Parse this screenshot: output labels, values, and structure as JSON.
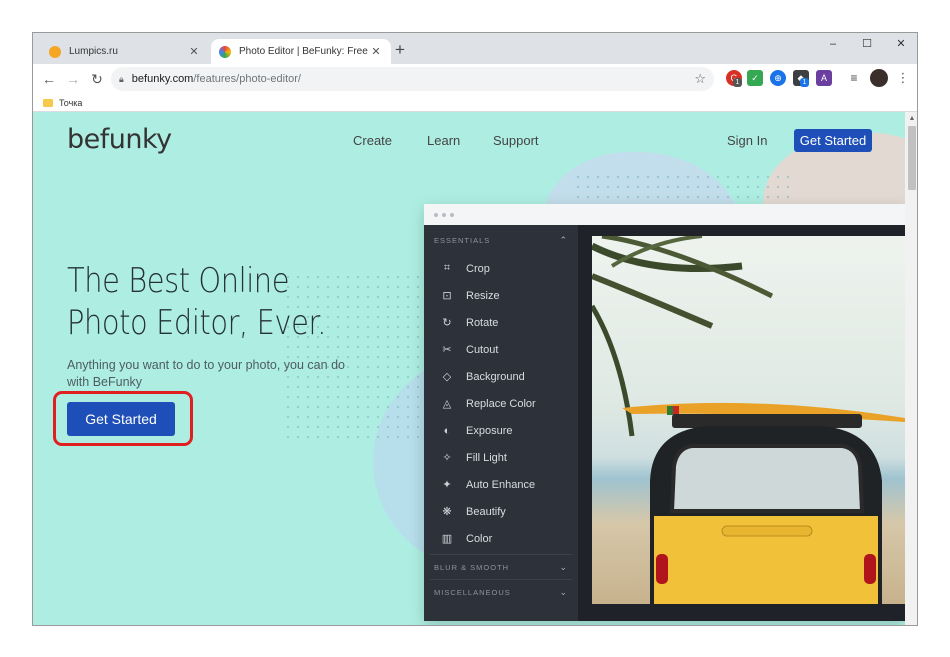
{
  "browser": {
    "tabs": [
      {
        "title": "Lumpics.ru",
        "favicon_color": "#f5a623",
        "active": false
      },
      {
        "title": "Photo Editor | BeFunky: Free Onl",
        "favicon_color": "#e8453c",
        "active": true
      }
    ],
    "new_tab_symbol": "+",
    "window_controls": [
      "–",
      "☐",
      "✕"
    ],
    "address": {
      "host": "befunky.com",
      "path": "/features/photo-editor/"
    },
    "bookmark": "Точка",
    "ext_badges": [
      "1",
      "1"
    ]
  },
  "site": {
    "logo": "befunky",
    "nav": [
      "Create",
      "Learn",
      "Support"
    ],
    "sign_in": "Sign In",
    "header_cta": "Get Started",
    "hero_title": "The Best Online Photo Editor, Ever.",
    "hero_subtitle": "Anything you want to do to your photo, you can do with BeFunky",
    "hero_cta": "Get Started",
    "accent_color": "#1e4eb7",
    "background_color": "#aeeee2"
  },
  "editor": {
    "section_title": "ESSENTIALS",
    "tools": [
      {
        "label": "Crop",
        "icon": "crop-icon",
        "glyph": "⌗"
      },
      {
        "label": "Resize",
        "icon": "resize-icon",
        "glyph": "⊡"
      },
      {
        "label": "Rotate",
        "icon": "rotate-icon",
        "glyph": "↻"
      },
      {
        "label": "Cutout",
        "icon": "scissors-icon",
        "glyph": "✂"
      },
      {
        "label": "Background",
        "icon": "background-icon",
        "glyph": "◇"
      },
      {
        "label": "Replace Color",
        "icon": "droplet-icon",
        "glyph": "◬"
      },
      {
        "label": "Exposure",
        "icon": "exposure-icon",
        "glyph": "◐"
      },
      {
        "label": "Fill Light",
        "icon": "sun-icon",
        "glyph": "✧"
      },
      {
        "label": "Auto Enhance",
        "icon": "sparkle-icon",
        "glyph": "✦"
      },
      {
        "label": "Beautify",
        "icon": "atom-icon",
        "glyph": "❋"
      },
      {
        "label": "Color",
        "icon": "color-icon",
        "glyph": "▥"
      }
    ],
    "collapsed_sections": [
      "BLUR & SMOOTH",
      "MISCELLANEOUS"
    ]
  }
}
